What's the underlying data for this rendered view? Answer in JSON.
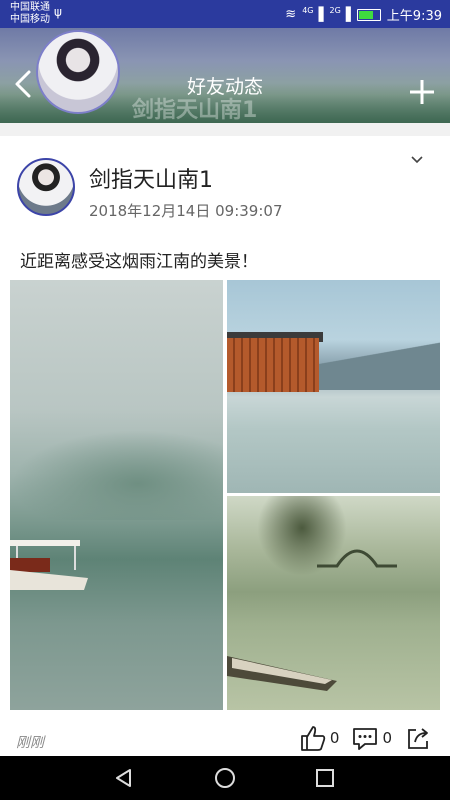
{
  "status_bar": {
    "carrier_1": "中国联通",
    "carrier_2": "中国移动",
    "signal_1_label": "4G",
    "signal_2_label": "2G",
    "time": "上午9:39",
    "battery_level": 0.7
  },
  "header": {
    "title": "好友动态",
    "ghost_title": "剑指天山南1"
  },
  "post": {
    "username": "剑指天山南1",
    "timestamp": "2018年12月14日 09:39:07",
    "text": "近距离感受这烟雨江南的美景！",
    "relative_time": "刚刚",
    "like_count": "0",
    "comment_count": "0"
  },
  "colors": {
    "status_bar": "#2b3a9e",
    "avatar_border": "#3c44a8"
  },
  "icons": {
    "back": "back-icon",
    "add": "plus-icon",
    "dropdown": "chevron-down-icon",
    "like": "thumbs-up-icon",
    "comment": "comment-icon",
    "share": "share-icon"
  }
}
